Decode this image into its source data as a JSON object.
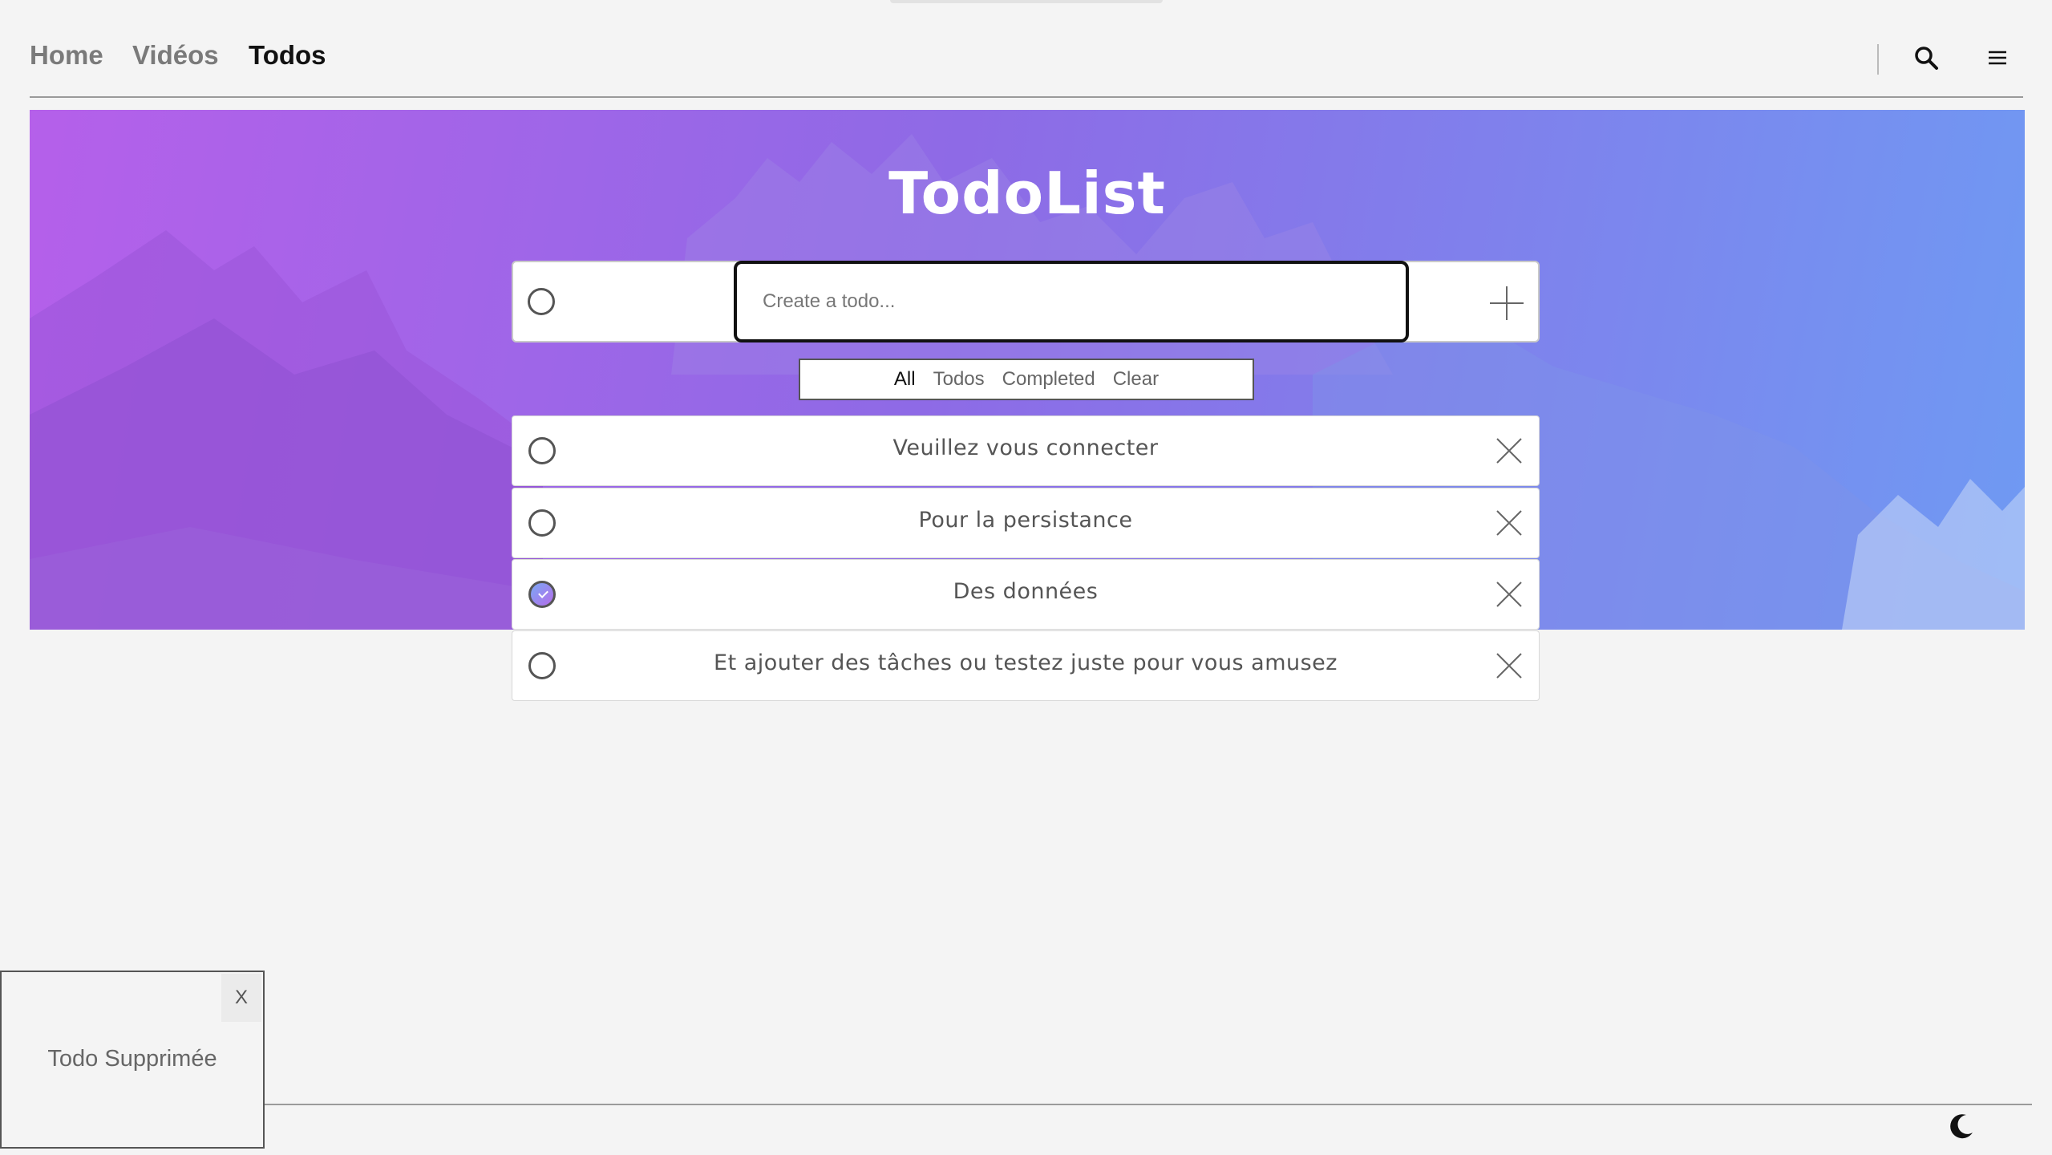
{
  "nav": {
    "links": [
      {
        "label": "Home",
        "active": false
      },
      {
        "label": "Vidéos",
        "active": false
      },
      {
        "label": "Todos",
        "active": true
      }
    ],
    "search_icon": "search-icon",
    "menu_icon": "hamburger-menu-icon"
  },
  "hero": {
    "title": "TodoList"
  },
  "create": {
    "placeholder": "Create a todo...",
    "add_icon": "plus-icon"
  },
  "filters": {
    "all": "All",
    "todos": "Todos",
    "completed": "Completed",
    "clear": "Clear",
    "active": "All"
  },
  "todos": [
    {
      "text": "Veuillez vous connecter",
      "completed": false
    },
    {
      "text": "Pour la persistance",
      "completed": false
    },
    {
      "text": "Des données",
      "completed": true
    },
    {
      "text": "Et ajouter des tâches ou testez juste pour vous amusez",
      "completed": false
    }
  ],
  "toast": {
    "close_label": "X",
    "message": "Todo Supprimée"
  },
  "footer": {
    "theme_icon": "moon-icon"
  },
  "colors": {
    "accent_gradient_start": "#b560ea",
    "accent_gradient_end": "#6f9af3",
    "background": "#f4f4f4"
  }
}
